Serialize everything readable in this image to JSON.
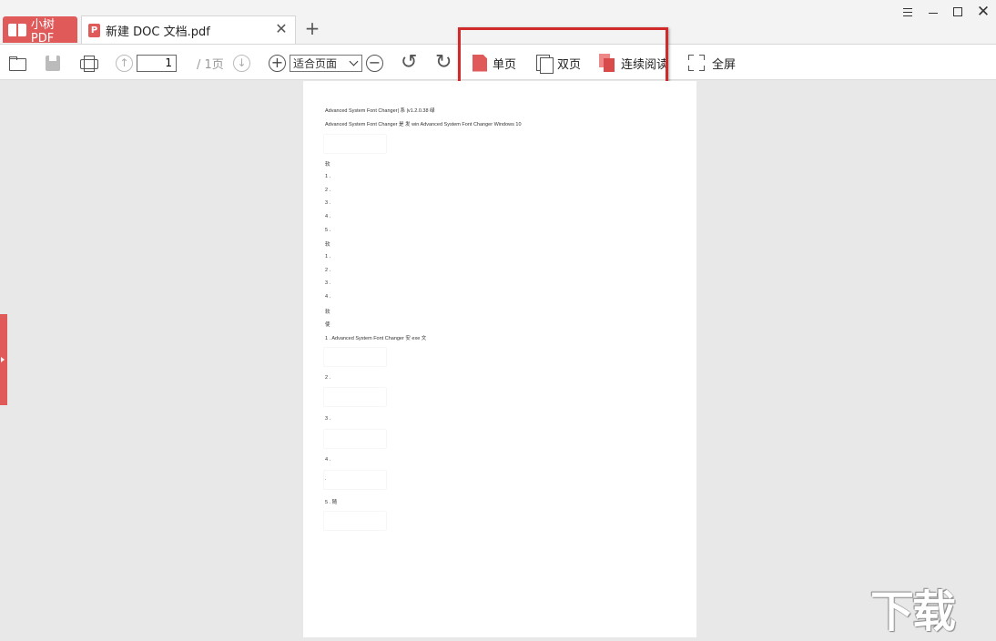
{
  "titlebar": {
    "app_name": "小树PDF",
    "doc_tab_badge": "P",
    "doc_tab_title": "新建 DOC 文档.pdf",
    "close_glyph": "✕",
    "add_glyph": "+"
  },
  "toolbar": {
    "page_current": "1",
    "page_total": "/ 1页",
    "zoom_value": "适合页面",
    "single_page": "单页",
    "double_page": "双页",
    "continuous_read": "连续阅读",
    "fullscreen": "全屏"
  },
  "document": {
    "lines": [
      "Advanced System Font Changer| 系 |v1.2.0.38 绿",
      "Advanced System Font Changer 是 发 win Advanced System Font Changer Windows 10",
      "软",
      "1 .",
      "2 .",
      "3 .",
      "4 .",
      "5 .",
      "软",
      "1 .",
      "2 .",
      "3 .",
      "4 .",
      "软",
      "使",
      "1 .   Advanced System Font Changer 安 exe 文",
      "2 .",
      "3 .",
      "4 .",
      ".",
      "5 .   随"
    ]
  },
  "watermark": "下载吧",
  "colors": {
    "accent": "#e05a5a",
    "highlight": "#d02a2a"
  },
  "icons": [
    "book-icon",
    "pdf-badge-icon",
    "close-icon",
    "plus-icon",
    "menu-icon",
    "minimize-icon",
    "maximize-icon",
    "window-close-icon",
    "folder-open-icon",
    "save-icon",
    "print-icon",
    "arrow-up-icon",
    "arrow-down-icon",
    "zoom-in-icon",
    "zoom-out-icon",
    "rotate-left-icon",
    "rotate-right-icon",
    "single-page-icon",
    "double-page-icon",
    "continuous-read-icon",
    "fullscreen-icon",
    "sidebar-toggle-icon"
  ]
}
